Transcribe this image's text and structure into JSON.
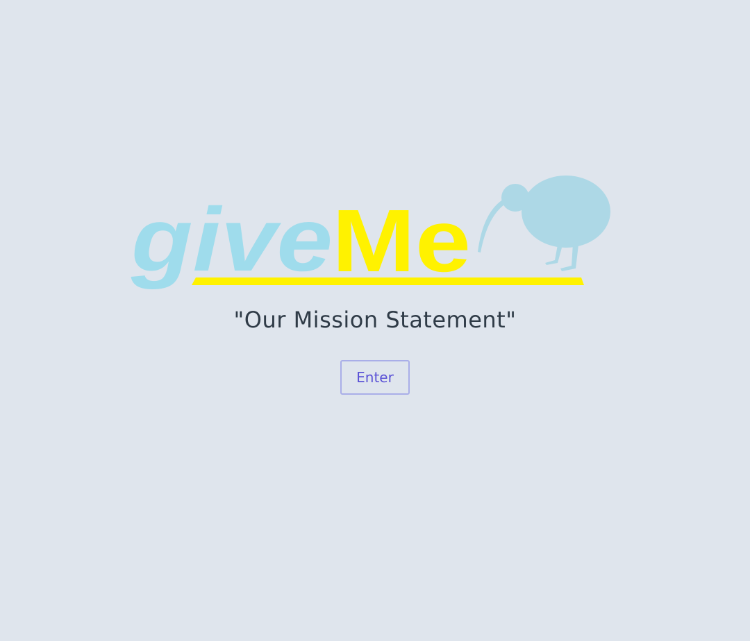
{
  "logo": {
    "text_part1": "give",
    "text_part2": "Me",
    "colors": {
      "give": "#9fdcec",
      "me": "#fff200",
      "underline": "#fff200",
      "kiwi": "#add8e6"
    },
    "icon": "kiwi-bird-icon"
  },
  "mission": {
    "text": "\"Our Mission Statement\""
  },
  "enter_button": {
    "label": "Enter"
  }
}
